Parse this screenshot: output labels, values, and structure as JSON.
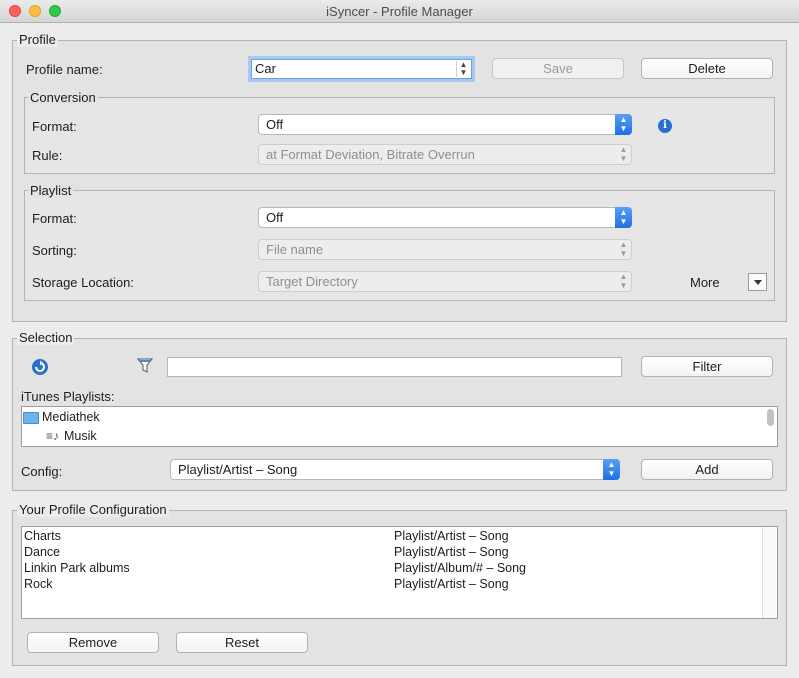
{
  "window": {
    "title": "iSyncer - Profile Manager"
  },
  "profile": {
    "legend": "Profile",
    "name_label": "Profile name:",
    "name_value": "Car",
    "save_label": "Save",
    "delete_label": "Delete"
  },
  "conversion": {
    "legend": "Conversion",
    "format_label": "Format:",
    "format_value": "Off",
    "rule_label": "Rule:",
    "rule_value": "at Format Deviation, Bitrate Overrun"
  },
  "playlist": {
    "legend": "Playlist",
    "format_label": "Format:",
    "format_value": "Off",
    "sorting_label": "Sorting:",
    "sorting_value": "File name",
    "storage_label": "Storage Location:",
    "storage_value": "Target Directory",
    "more_label": "More"
  },
  "selection": {
    "legend": "Selection",
    "filter_value": "",
    "filter_label": "Filter",
    "itunes_label": "iTunes Playlists:",
    "tree": [
      {
        "label": "Mediathek",
        "icon": "folder-icon"
      },
      {
        "label": "Musik",
        "icon": "music-list-icon"
      }
    ],
    "config_label": "Config:",
    "config_value": "Playlist/Artist – Song",
    "add_label": "Add"
  },
  "your_config": {
    "legend": "Your Profile Configuration",
    "rows": [
      {
        "name": "Charts",
        "config": "Playlist/Artist – Song"
      },
      {
        "name": "Dance",
        "config": "Playlist/Artist – Song"
      },
      {
        "name": "Linkin Park albums",
        "config": "Playlist/Album/# – Song"
      },
      {
        "name": "Rock",
        "config": "Playlist/Artist – Song"
      }
    ],
    "remove_label": "Remove",
    "reset_label": "Reset"
  },
  "colors": {
    "accent": "#1f6fe5",
    "focus_ring": "#a9c9f1",
    "folder": "#6fb3ea"
  }
}
